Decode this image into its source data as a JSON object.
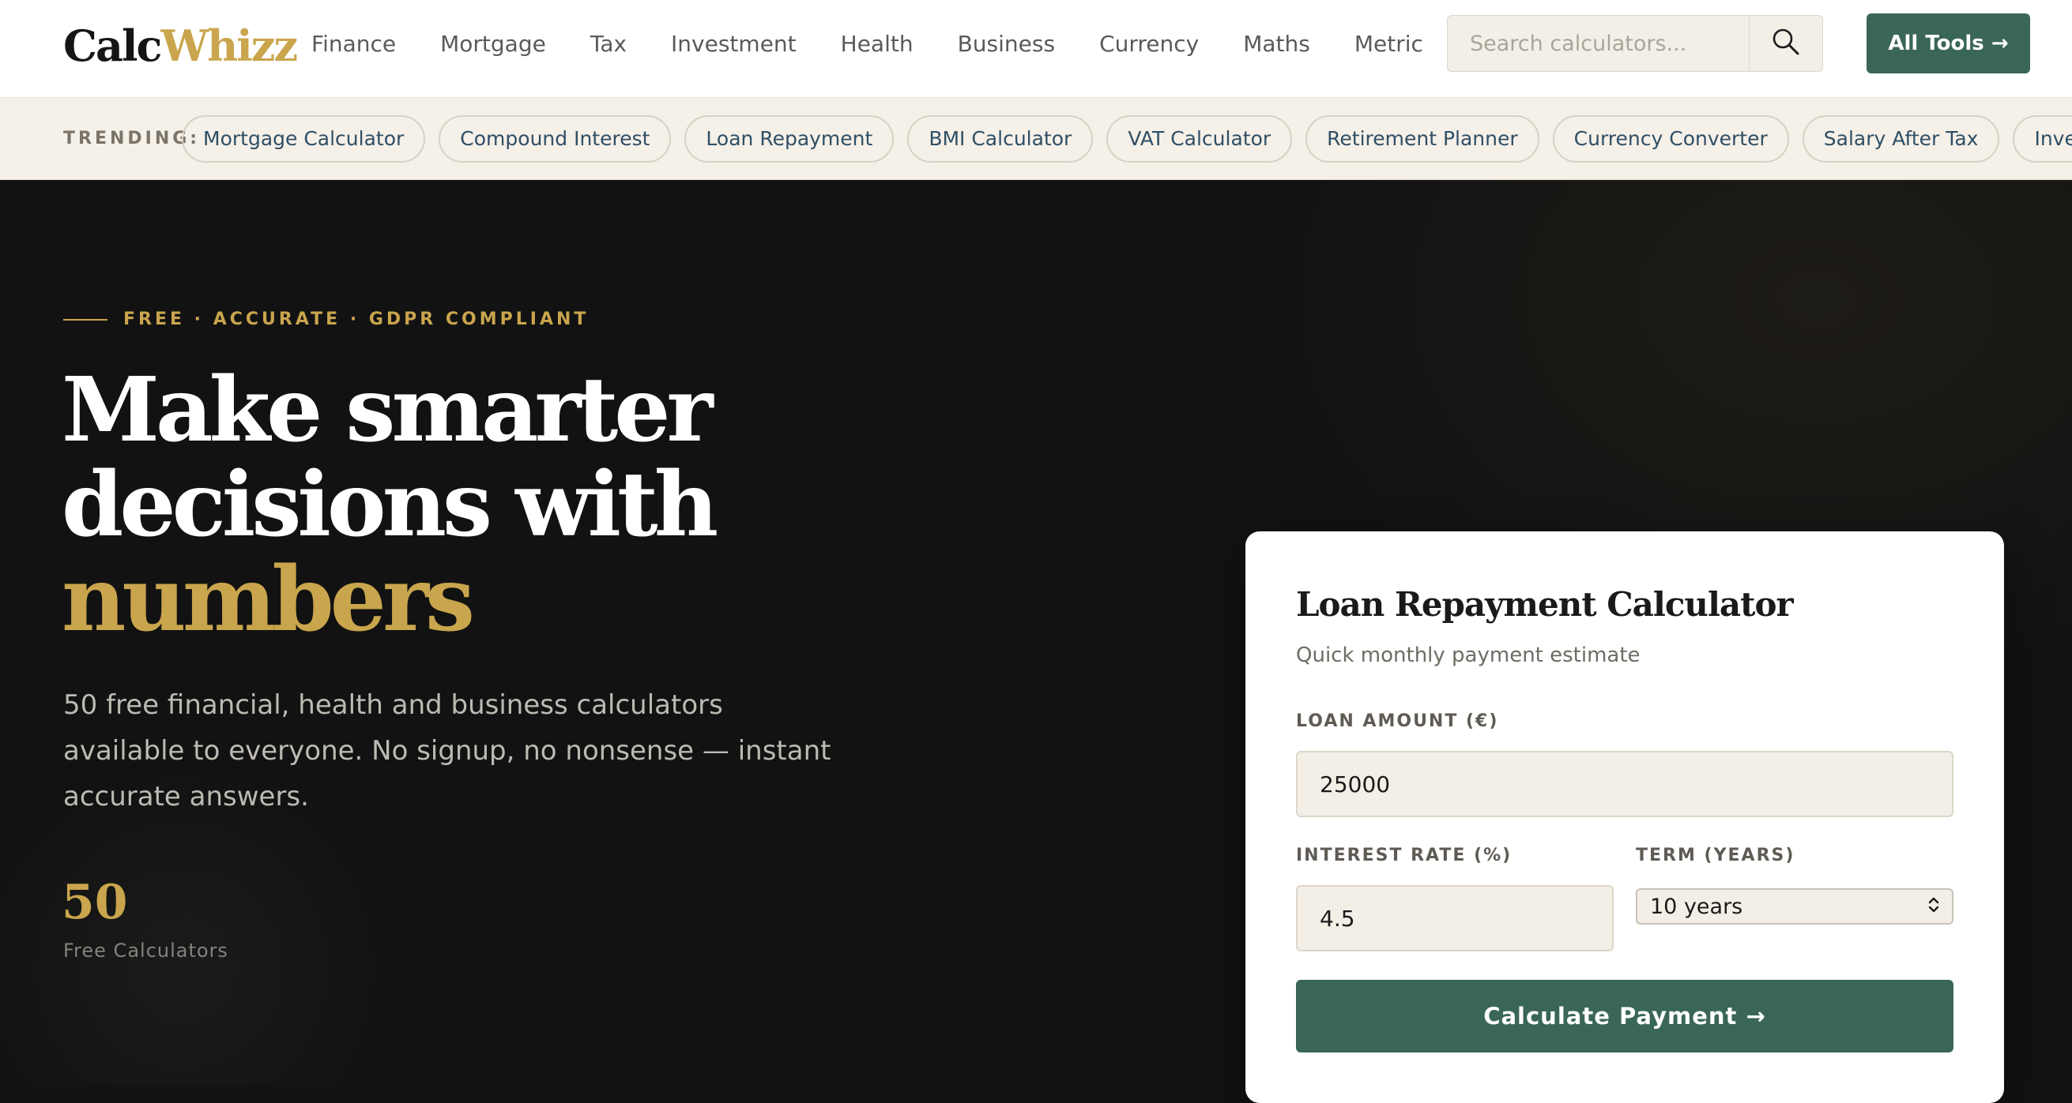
{
  "brand": {
    "part1": "Calc",
    "part2": "Whizz"
  },
  "nav": [
    {
      "label": "Finance"
    },
    {
      "label": "Mortgage"
    },
    {
      "label": "Tax"
    },
    {
      "label": "Investment"
    },
    {
      "label": "Health"
    },
    {
      "label": "Business"
    },
    {
      "label": "Currency"
    },
    {
      "label": "Maths"
    },
    {
      "label": "Metric"
    }
  ],
  "search": {
    "placeholder": "Search calculators..."
  },
  "all_tools": {
    "label": "All Tools →"
  },
  "trending": {
    "label": "TRENDING:",
    "items": [
      {
        "label": "Mortgage Calculator"
      },
      {
        "label": "Compound Interest"
      },
      {
        "label": "Loan Repayment"
      },
      {
        "label": "BMI Calculator"
      },
      {
        "label": "VAT Calculator"
      },
      {
        "label": "Retirement Planner"
      },
      {
        "label": "Currency Converter"
      },
      {
        "label": "Salary After Tax"
      },
      {
        "label": "Investment Returns"
      }
    ]
  },
  "hero": {
    "eyebrow": "FREE · ACCURATE · GDPR COMPLIANT",
    "headline_line1": "Make smarter",
    "headline_line2": "decisions with",
    "headline_accent": "numbers",
    "subtext": "50 free financial, health and business calculators available to everyone. No signup, no nonsense — instant accurate answers.",
    "stat_number": "50",
    "stat_label": "Free Calculators"
  },
  "calculator": {
    "title": "Loan Repayment Calculator",
    "subtitle": "Quick monthly payment estimate",
    "loan_amount_label": "LOAN AMOUNT (€)",
    "loan_amount_value": "25000",
    "interest_label": "INTEREST RATE (%)",
    "interest_value": "4.5",
    "term_label": "TERM (YEARS)",
    "term_value": "10 years",
    "button_label": "Calculate Payment →"
  },
  "colors": {
    "accent_gold": "#c9a54d",
    "brand_green": "#3a6657",
    "hero_background": "#121212",
    "trending_background": "#f5f0e8",
    "input_background": "#f4efe6",
    "pill_text": "#2f4f66"
  },
  "icons": {
    "search": "magnifier-icon",
    "select_arrows": "chevron-up-down-icon"
  }
}
